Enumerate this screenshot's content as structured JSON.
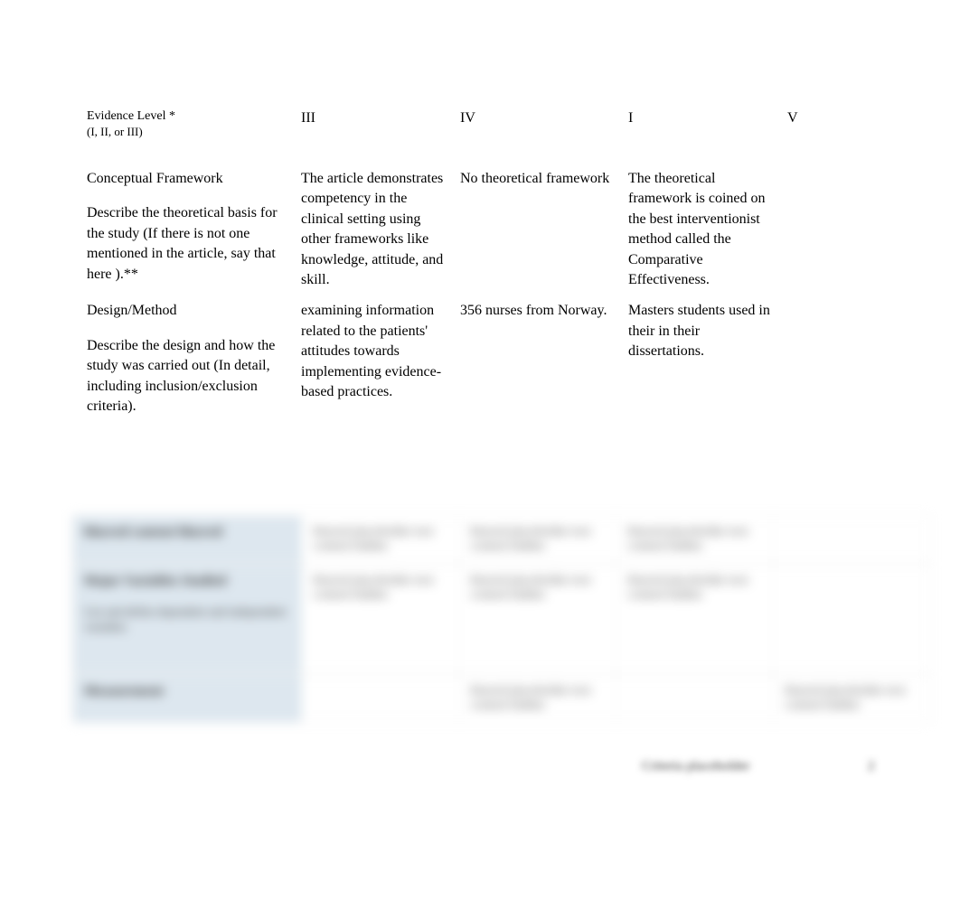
{
  "rows": {
    "evidence": {
      "label_main": "Evidence Level *",
      "label_sub": "(I, II, or III)",
      "a": "III",
      "b": "IV",
      "c": "I",
      "d": "V"
    },
    "conceptual": {
      "title": "Conceptual Framework",
      "desc": "Describe the theoretical basis for the study (If there is not one mentioned in the article, say that here  ).**",
      "a": "The article demonstrates competency in the clinical setting using other frameworks like knowledge, attitude, and skill.",
      "b": "No theoretical framework",
      "c": "The theoretical framework is coined on the best interventionist method called the Comparative Effectiveness.",
      "d": ""
    },
    "design": {
      "title": "Design/Method",
      "desc": "Describe the design and how the study was carried out (In detail, including inclusion/exclusion criteria).",
      "a": "examining information related to the patients' attitudes towards implementing evidence-based practices.",
      "b": "356 nurses from Norway.",
      "c": "Masters students used in their in their dissertations.",
      "d": ""
    }
  },
  "blurred": {
    "row1_label": "blurred content blurred",
    "row2_label": "Major Variables Studied",
    "row2_sub": "List and define dependent and independent variables",
    "row3_label": "Measurement",
    "generic": "blurred placeholder text content hidden"
  },
  "footer": {
    "text": "Criteria placeholder",
    "num": "2"
  }
}
